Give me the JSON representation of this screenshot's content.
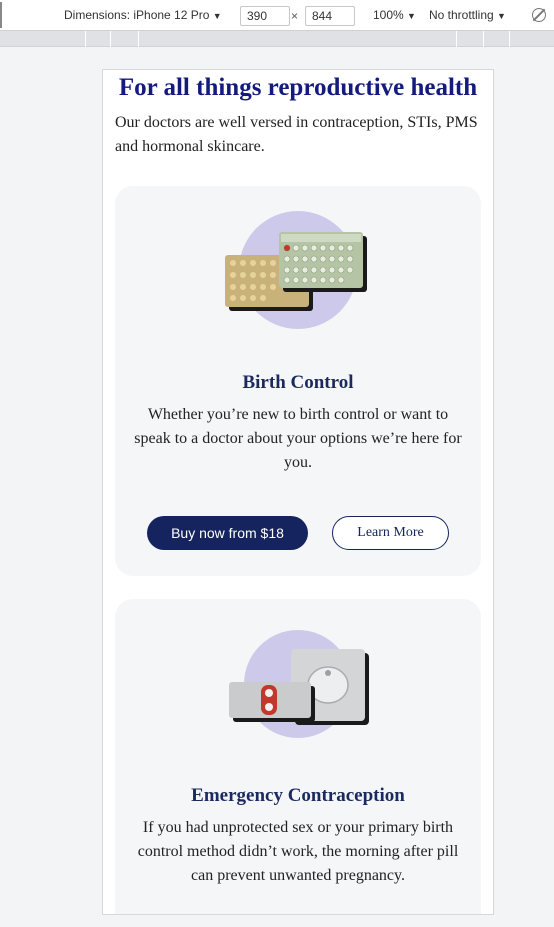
{
  "devtools": {
    "device_label": "Dimensions: iPhone 12 Pro",
    "width_value": "390",
    "times": "×",
    "height_value": "844",
    "zoom_label": "100%",
    "throttle_label": "No throttling",
    "caret": "▼"
  },
  "page": {
    "heading": "For all things reproductive health",
    "intro": "Our doctors are well versed in contraception, STIs, PMS and hormonal skincare."
  },
  "cards": [
    {
      "title": "Birth Control",
      "description": "Whether you’re new to birth control or want to speak to a doctor about your options we’re here for you.",
      "buy_label": "Buy now from $18",
      "more_label": "Learn More",
      "image_icon": "pill-pack-icon"
    },
    {
      "title": "Emergency Contraception",
      "description": "If you had unprotected sex or your primary birth control method didn’t work, the morning after pill can prevent unwanted pregnancy.",
      "image_icon": "emergency-pill-blister-icon"
    }
  ],
  "colors": {
    "heading": "#141a7e",
    "card_title": "#1b2a5e",
    "button_primary": "#15245f",
    "card_bg": "#f5f6f8",
    "accent_circle": "#cdc9ea"
  }
}
